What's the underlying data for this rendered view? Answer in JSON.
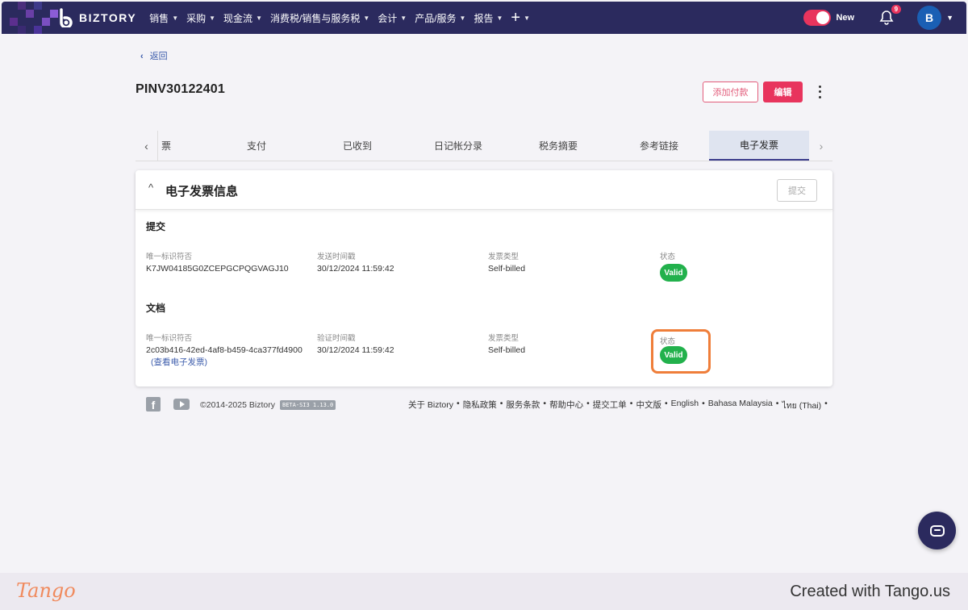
{
  "brand": {
    "name": "BIZTORY"
  },
  "nav": {
    "items": [
      {
        "label": "销售"
      },
      {
        "label": "采购"
      },
      {
        "label": "现金流"
      },
      {
        "label": "消费税/销售与服务税"
      },
      {
        "label": "会计"
      },
      {
        "label": "产品/服务"
      },
      {
        "label": "报告"
      }
    ],
    "new_label": "New",
    "notification_count": "9",
    "avatar_initial": "B"
  },
  "page": {
    "back_label": "返回",
    "title": "PINV30122401",
    "add_payment_label": "添加付款",
    "edit_label": "编辑"
  },
  "tabs": [
    {
      "label": "票"
    },
    {
      "label": "支付"
    },
    {
      "label": "已收到"
    },
    {
      "label": "日记帐分录"
    },
    {
      "label": "税务摘要"
    },
    {
      "label": "参考链接"
    },
    {
      "label": "电子发票"
    }
  ],
  "einvoice": {
    "title": "电子发票信息",
    "submit_label": "提交",
    "submission": {
      "heading": "提交",
      "uid_label": "唯一标识符否",
      "uid_value": "K7JW04185G0ZCEPGCPQGVAGJ10",
      "time_label": "发送时间戳",
      "time_value": "30/12/2024 11:59:42",
      "type_label": "发票类型",
      "type_value": "Self-billed",
      "status_label": "状态",
      "status_value": "Valid"
    },
    "document": {
      "heading": "文档",
      "uid_label": "唯一标识符否",
      "uid_value": "2c03b416-42ed-4af8-b459-4ca377fd4900",
      "view_link": "(查看电子发票)",
      "time_label": "验证时间戳",
      "time_value": "30/12/2024 11:59:42",
      "type_label": "发票类型",
      "type_value": "Self-billed",
      "status_label": "状态",
      "status_value": "Valid"
    }
  },
  "footer": {
    "copyright": "©2014-2025 Biztory",
    "version": "BETA-SI3 1.13.0",
    "links": [
      "关于 Biztory",
      "隐私政策",
      "服务条款",
      "帮助中心",
      "提交工单",
      "中文版",
      "English",
      "Bahasa Malaysia",
      "ไทย (Thai)"
    ],
    "separator": "•"
  },
  "tango": {
    "logo": "Tango",
    "created": "Created with Tango.us"
  },
  "colors": {
    "nav_bg": "#2b2a5e",
    "accent": "#e8345d",
    "valid": "#22b14c",
    "highlight": "#ef7e3a"
  }
}
